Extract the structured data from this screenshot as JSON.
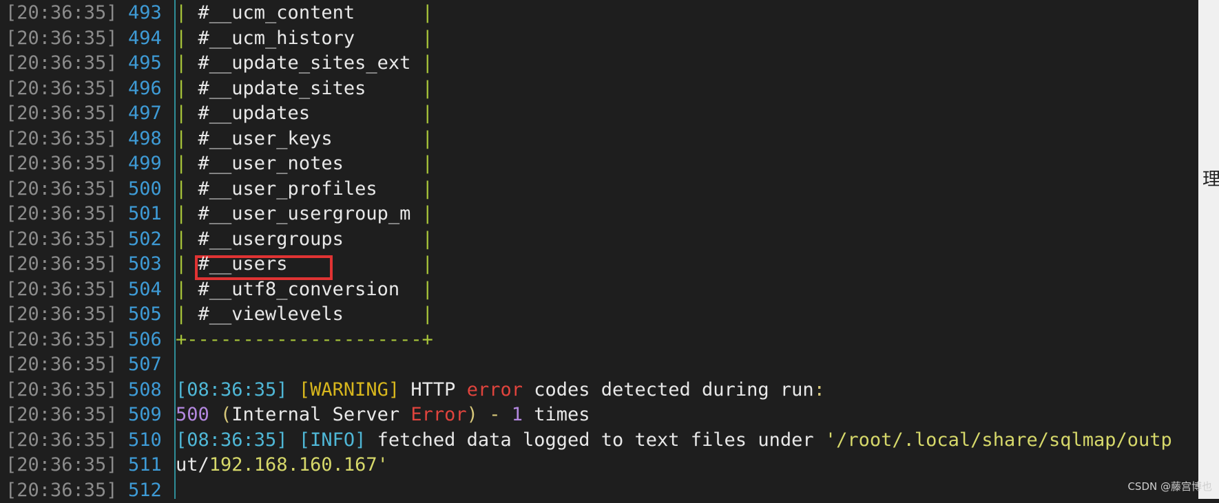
{
  "terminal": {
    "lines": [
      {
        "time": "[20:36:35]",
        "num": "493",
        "kind": "row",
        "name": "#__ucm_content"
      },
      {
        "time": "[20:36:35]",
        "num": "494",
        "kind": "row",
        "name": "#__ucm_history"
      },
      {
        "time": "[20:36:35]",
        "num": "495",
        "kind": "row",
        "name": "#__update_sites_ext"
      },
      {
        "time": "[20:36:35]",
        "num": "496",
        "kind": "row",
        "name": "#__update_sites"
      },
      {
        "time": "[20:36:35]",
        "num": "497",
        "kind": "row",
        "name": "#__updates"
      },
      {
        "time": "[20:36:35]",
        "num": "498",
        "kind": "row",
        "name": "#__user_keys"
      },
      {
        "time": "[20:36:35]",
        "num": "499",
        "kind": "row",
        "name": "#__user_notes"
      },
      {
        "time": "[20:36:35]",
        "num": "500",
        "kind": "row",
        "name": "#__user_profiles"
      },
      {
        "time": "[20:36:35]",
        "num": "501",
        "kind": "row",
        "name": "#__user_usergroup_m"
      },
      {
        "time": "[20:36:35]",
        "num": "502",
        "kind": "row",
        "name": "#__usergroups"
      },
      {
        "time": "[20:36:35]",
        "num": "503",
        "kind": "row",
        "name": "#__users",
        "highlighted": true
      },
      {
        "time": "[20:36:35]",
        "num": "504",
        "kind": "row",
        "name": "#__utf8_conversion"
      },
      {
        "time": "[20:36:35]",
        "num": "505",
        "kind": "row",
        "name": "#__viewlevels"
      },
      {
        "time": "[20:36:35]",
        "num": "506",
        "kind": "border",
        "text": "+---------------------+"
      },
      {
        "time": "[20:36:35]",
        "num": "507",
        "kind": "empty"
      },
      {
        "time": "[20:36:35]",
        "num": "508",
        "kind": "warning",
        "stamp": "[08:36:35]",
        "level": "[WARNING]",
        "pre": "HTTP ",
        "err": "error",
        "post": " codes detected during run",
        "colon": ":"
      },
      {
        "time": "[20:36:35]",
        "num": "509",
        "kind": "status",
        "code": "500",
        "open": " (",
        "a": "Internal Server ",
        "err": "Error",
        "close": ")",
        "dash": " - ",
        "count": "1",
        "tail": " times"
      },
      {
        "time": "[20:36:35]",
        "num": "510",
        "kind": "info",
        "stamp": "[08:36:35]",
        "level": "[INFO]",
        "text": " fetched data logged to text files under ",
        "path": "'/root/.local/share/sqlmap/outp"
      },
      {
        "time": "[20:36:35]",
        "num": "511",
        "kind": "cont",
        "pre": "ut/",
        "path": "192.168.160.167'"
      },
      {
        "time": "[20:36:35]",
        "num": "512",
        "kind": "empty"
      }
    ],
    "pipe_char": "|"
  },
  "side_glyph": "理",
  "watermark": "CSDN @藤宫博也",
  "colors": {
    "background": "#1e1e1e",
    "timestamp": "#8c8c8c",
    "line_number": "#3e9bd6",
    "table_border": "#a8c53a",
    "warning": "#d7b61d",
    "error": "#e0443d",
    "highlight_box": "#e03333"
  }
}
